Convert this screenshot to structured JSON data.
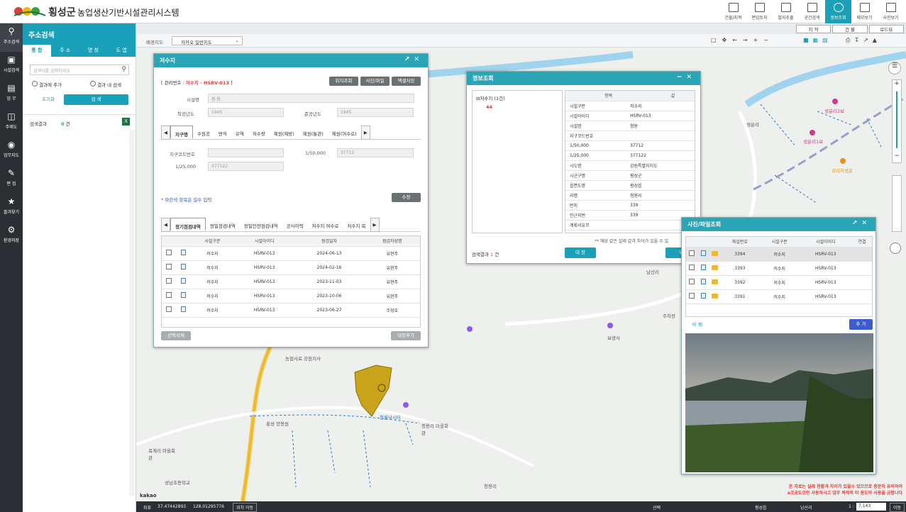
{
  "header": {
    "org": "횡성군",
    "title": "농업생산기반시설관리시스템"
  },
  "toolbar": [
    {
      "label": "건물/지적"
    },
    {
      "label": "편입토지"
    },
    {
      "label": "필지추출"
    },
    {
      "label": "공간검색"
    },
    {
      "label": "정보조회"
    },
    {
      "label": "메모보기"
    },
    {
      "label": "사진보기"
    }
  ],
  "sidebar": [
    {
      "label": "주소검색"
    },
    {
      "label": "시설검색"
    },
    {
      "label": "업 무"
    },
    {
      "label": "주제도"
    },
    {
      "label": "업무지도"
    },
    {
      "label": "편 집"
    },
    {
      "label": "즐겨찾기"
    },
    {
      "label": "환경저장"
    }
  ],
  "search": {
    "title": "주소검색",
    "tabs": [
      "통 합",
      "주 소",
      "명 칭",
      "도 엽"
    ],
    "placeholder": "검색어를 입력하세요",
    "opt1": "결과에 추가",
    "opt2": "결과 내 검색",
    "reset": "초기화",
    "search": "검 색",
    "result_label": "검색결과",
    "result_count": "0",
    "result_unit": "건"
  },
  "mapbar": {
    "basemap_label": "배경지도",
    "basemap_value": "카카오 일반지도",
    "tabs": [
      "지 적",
      "건 물",
      "로드뷰"
    ]
  },
  "status": {
    "coord_label": "좌표",
    "lat": "37.47442893",
    "lon": "128.01295776",
    "move": "위치 이동",
    "select": "선택",
    "dong": "횡성읍",
    "ri": "남산리",
    "scale_prefix": "1 :",
    "scale": "7,143",
    "go": "이동",
    "brand": "kakao"
  },
  "reservoir": {
    "title": "저수지",
    "id_prefix": "[ 관리번호 :",
    "id_value": "저수지 - HSRV-013",
    "id_suffix": "]",
    "btn_loc": "위치조회",
    "btn_photo": "사진/파일",
    "btn_excel": "엑셀저장",
    "f_name": "시설명",
    "v_name": "청 용",
    "f_start": "착공년도",
    "v_start": "1945",
    "f_end": "준공년도",
    "v_end": "1945",
    "tabs": [
      "지구명",
      "수원공",
      "면적",
      "유역",
      "저수량",
      "제원(제방)",
      "제원(통관)",
      "제원(여수로)"
    ],
    "f_code": "지구코드번호",
    "f_50k": "1/50,000",
    "v_50k": "37712",
    "f_25k": "1/25,000",
    "v_25k": "377122",
    "note": "* 파란색 항목은 필수 입력",
    "modify": "수정",
    "tabs2": [
      "정기점검내역",
      "정밀점검내역",
      "정밀안전점검내역",
      "공사이력",
      "저수지 여수로",
      "저수지 복"
    ],
    "cols": [
      "시설구분",
      "시설아이디",
      "점검일자",
      "점검자성명"
    ],
    "rows": [
      {
        "type": "저수지",
        "id": "HSRV-013",
        "date": "2024-06-13",
        "who": "유현주"
      },
      {
        "type": "저수지",
        "id": "HSRV-013",
        "date": "2024-02-16",
        "who": "유현주"
      },
      {
        "type": "저수지",
        "id": "HSRV-013",
        "date": "2023-11-03",
        "who": "유현주"
      },
      {
        "type": "저수지",
        "id": "HSRV-013",
        "date": "2023-10-06",
        "who": "유현주"
      },
      {
        "type": "저수지",
        "id": "HSRV-013",
        "date": "2023-06-27",
        "who": "조성호"
      }
    ],
    "del": "선택삭제",
    "add": "대장추가"
  },
  "info": {
    "title": "정보조회",
    "tree_root": "저수지 (1건)",
    "tree_child": "44",
    "col_item": "항목",
    "col_val": "값",
    "rows": [
      {
        "k": "시설구분",
        "v": "저수지"
      },
      {
        "k": "시설아이디",
        "v": "HSRV-013"
      },
      {
        "k": "시설명",
        "v": "청용"
      },
      {
        "k": "지구코드번호",
        "v": ""
      },
      {
        "k": "1/50,000",
        "v": "37712"
      },
      {
        "k": "1/25,000",
        "v": "377122"
      },
      {
        "k": "시도명",
        "v": "강원특별자치도"
      },
      {
        "k": "시군구명",
        "v": "횡성군"
      },
      {
        "k": "읍면도명",
        "v": "횡성읍"
      },
      {
        "k": "리명",
        "v": "청용리"
      },
      {
        "k": "번지",
        "v": "339"
      },
      {
        "k": "인근지번",
        "v": "339"
      },
      {
        "k": "계획서유무",
        "v": ""
      }
    ],
    "note": "* 해당 값은 실제 값과 차이가 있을 수 있",
    "result_label": "검색결과",
    "result_count": "1",
    "result_unit": "건",
    "btn": "대 장",
    "btn2": "위"
  },
  "photo": {
    "title": "사진/파일조회",
    "cols": [
      "파일번호",
      "시설구분",
      "시설아이디",
      "연결"
    ],
    "rows": [
      {
        "no": "3394",
        "type": "저수지",
        "id": "HSRV-013"
      },
      {
        "no": "3393",
        "type": "저수지",
        "id": "HSRV-013"
      },
      {
        "no": "3392",
        "type": "저수지",
        "id": "HSRV-013"
      },
      {
        "no": "3391",
        "type": "저수지",
        "id": "HSRV-013"
      }
    ],
    "del": "삭 제",
    "add": "추 가",
    "warn1": "본 자료는 실제 현황과 차이가 있을수 있으므로 충분히 유의하여",
    "warn2": "a코공도으만 사용하시고 업무 목적외 타 용도의 사용을 금합니다"
  },
  "map_labels": {
    "l1": "생운리",
    "l2": "남산리",
    "l3": "보광사",
    "l4": "청용리",
    "l5": "횡성 양봉원",
    "l6": "농협사료 강원지사",
    "l7": "청용리 마을회관",
    "l8": "목계리 마을회관",
    "l9": "성남초등학교",
    "l10": "청룡낚시터",
    "l11": "코리치생운",
    "l12": "주차장",
    "l13": "생운리1보",
    "l14": "생운리2보"
  }
}
